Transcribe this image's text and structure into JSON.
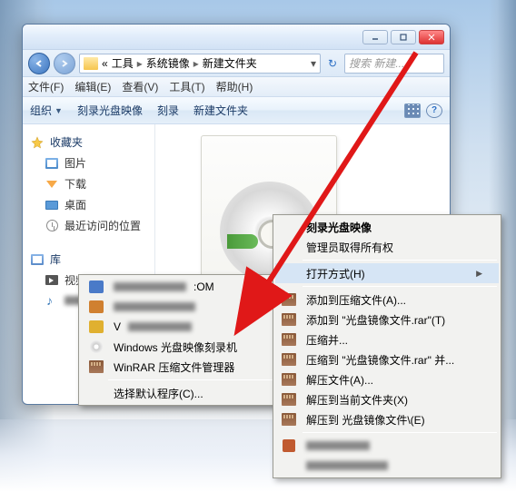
{
  "breadcrumb": {
    "level1": "工具",
    "level2": "系统镜像",
    "level3": "新建文件夹",
    "prefix": "«"
  },
  "searchbox": {
    "placeholder": "搜索 新建..."
  },
  "menubar": {
    "file": "文件(F)",
    "edit": "编辑(E)",
    "view": "查看(V)",
    "tools": "工具(T)",
    "help": "帮助(H)"
  },
  "toolbar": {
    "organize": "组织",
    "burn": "刻录光盘映像",
    "burn2": "刻录",
    "newfolder": "新建文件夹"
  },
  "sidebar": {
    "favorites": "收藏夹",
    "items": [
      "图片",
      "下载",
      "桌面",
      "最近访问的位置"
    ],
    "library": "库",
    "lib_items": [
      "视频"
    ]
  },
  "ctx1": {
    "com_suffix": ":OM",
    "windows_burner": "Windows 光盘映像刻录机",
    "winrar_mgr": "WinRAR 压缩文件管理器",
    "choose_default": "选择默认程序(C)..."
  },
  "ctx2": {
    "burn_image": "刻录光盘映像",
    "admin": "管理员取得所有权",
    "open_with": "打开方式(H)",
    "add_archive": "添加到压缩文件(A)...",
    "add_rar": "添加到 \"光盘镜像文件.rar\"(T)",
    "compress_and": "压缩并...",
    "compress_to_rar": "压缩到 \"光盘镜像文件.rar\" 并...",
    "extract": "解压文件(A)...",
    "extract_here": "解压到当前文件夹(X)",
    "extract_to": "解压到 光盘镜像文件\\(E)"
  }
}
